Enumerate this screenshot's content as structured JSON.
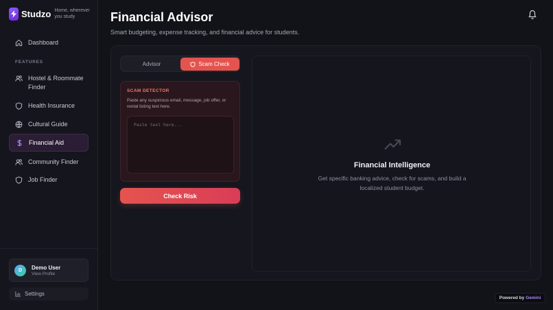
{
  "brand": {
    "name": "Studzo",
    "tagline": "Home, wherever you study"
  },
  "sidebar": {
    "section_label": "FEATURES",
    "dashboard": {
      "label": "Dashboard",
      "icon": "home-icon"
    },
    "items": [
      {
        "label": "Hostel & Roommate Finder",
        "icon": "users-icon"
      },
      {
        "label": "Health Insurance",
        "icon": "shield-icon"
      },
      {
        "label": "Cultural Guide",
        "icon": "globe-icon"
      },
      {
        "label": "Financial Aid",
        "icon": "dollar-icon",
        "active": true
      },
      {
        "label": "Community Finder",
        "icon": "users-icon"
      },
      {
        "label": "Job Finder",
        "icon": "shield-icon"
      }
    ],
    "user": {
      "initial": "D",
      "name": "Demo User",
      "sub": "View Profile"
    },
    "settings": {
      "label": "Settings",
      "icon": "bar-chart-icon"
    }
  },
  "header": {
    "title": "Financial Advisor",
    "subtitle": "Smart budgeting, expense tracking, and financial advice for students.",
    "bell_icon": "bell-icon"
  },
  "tabs": [
    {
      "label": "Advisor",
      "active": false
    },
    {
      "label": "Scam Check",
      "active": true,
      "icon": "shield-icon"
    }
  ],
  "scam_detector": {
    "title": "SCAM DETECTOR",
    "description": "Paste any suspicious email, message, job offer, or rental listing text here.",
    "placeholder": "Paste text here...",
    "value": ""
  },
  "check_button": {
    "label": "Check Risk"
  },
  "intelligence": {
    "icon": "trending-up-icon",
    "title": "Financial Intelligence",
    "description": "Get specific banking advice, check for scams, and build a localized student budget."
  },
  "footer": {
    "powered_prefix": "Powered by",
    "powered_brand": "Gemini"
  },
  "colors": {
    "accent": "#e4544f",
    "brand_purple": "#8b5cf6",
    "background": "#121219"
  }
}
